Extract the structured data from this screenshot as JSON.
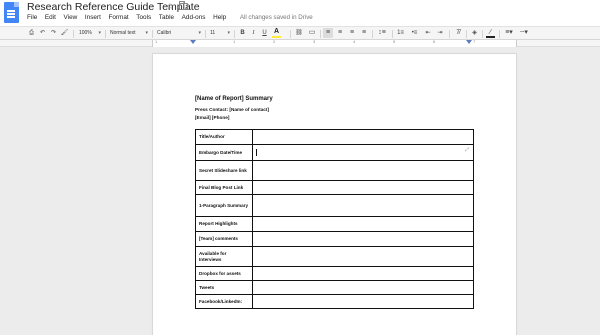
{
  "header": {
    "title": "Research Reference Guide Template",
    "saved_status": "All changes saved in Drive"
  },
  "menu": [
    "File",
    "Edit",
    "View",
    "Insert",
    "Format",
    "Tools",
    "Table",
    "Add-ons",
    "Help"
  ],
  "toolbar": {
    "zoom": "100%",
    "style": "Normal text",
    "font": "Calibri",
    "font_size": "11",
    "highlight_color": "#ffeb3b",
    "text_color": "#222222"
  },
  "ruler": {
    "numbers": [
      "1",
      "1",
      "2",
      "3",
      "4",
      "5",
      "6",
      "7"
    ]
  },
  "document": {
    "title": "[Name of Report] Summary",
    "press_contact": "Press Contact: [Name of contact]",
    "contact_info": "[Email] [Phone]",
    "table_rows": [
      {
        "label": "Title/Author",
        "value": ""
      },
      {
        "label": "Embargo Date/Time",
        "value": ""
      },
      {
        "label": "Secret Slideshare link",
        "value": ""
      },
      {
        "label": "Final Blog Post Link",
        "value": ""
      },
      {
        "label": "1-Paragraph Summary",
        "value": ""
      },
      {
        "label": "Report Highlights",
        "value": ""
      },
      {
        "label": "[Team] comments",
        "value": ""
      },
      {
        "label": "Available for Interviews",
        "value": ""
      },
      {
        "label": "Dropbox for assets",
        "value": ""
      },
      {
        "label": "Tweets",
        "value": ""
      },
      {
        "label": "Facebook/LinkedIn:",
        "value": ""
      }
    ]
  }
}
